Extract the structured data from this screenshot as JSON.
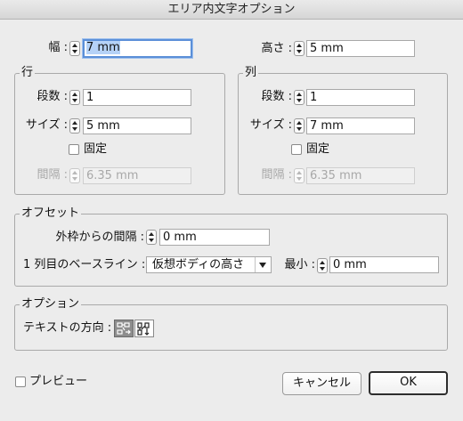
{
  "window": {
    "title": "エリア内文字オプション"
  },
  "size": {
    "width_label": "幅 :",
    "width_value": "7 mm",
    "height_label": "高さ :",
    "height_value": "5 mm"
  },
  "rows": {
    "title": "行",
    "count_label": "段数 :",
    "count_value": "1",
    "size_label": "サイズ :",
    "size_value": "5 mm",
    "fixed_label": "固定",
    "gutter_label": "間隔 :",
    "gutter_value": "6.35 mm"
  },
  "columns": {
    "title": "列",
    "count_label": "段数 :",
    "count_value": "1",
    "size_label": "サイズ :",
    "size_value": "7 mm",
    "fixed_label": "固定",
    "gutter_label": "間隔 :",
    "gutter_value": "6.35 mm"
  },
  "offset": {
    "title": "オフセット",
    "inset_label": "外枠からの間隔 :",
    "inset_value": "0 mm",
    "baseline_label": "1 列目のベースライン :",
    "baseline_selected": "仮想ボディの高さ",
    "min_label": "最小 :",
    "min_value": "0 mm"
  },
  "options": {
    "title": "オプション",
    "flow_label": "テキストの方向 :",
    "flow_icons": [
      "text-flow-by-rows-icon",
      "text-flow-by-columns-icon"
    ],
    "flow_active": "text-flow-by-rows-icon"
  },
  "footer": {
    "preview_label": "プレビュー",
    "cancel_label": "キャンセル",
    "ok_label": "OK"
  }
}
